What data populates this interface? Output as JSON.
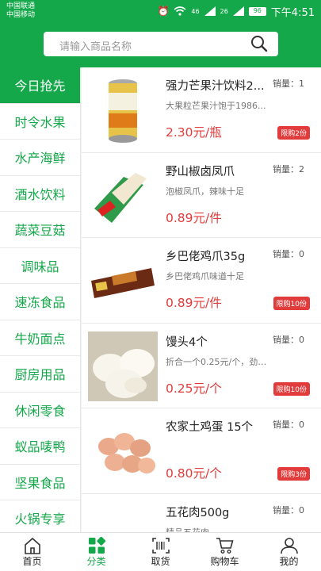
{
  "status_bar": {
    "carrier_1": "中国联通",
    "carrier_2": "中国移动",
    "network_1": "46",
    "network_2": "26",
    "battery": "96",
    "time": "下午4:51"
  },
  "search": {
    "placeholder": "请输入商品名称",
    "icon": "search-icon"
  },
  "accent_color": "#14a84a",
  "price_color": "#e23b3b",
  "categories": [
    {
      "label": "今日抢先",
      "active": true
    },
    {
      "label": "时令水果"
    },
    {
      "label": "水产海鲜"
    },
    {
      "label": "酒水饮料"
    },
    {
      "label": "蔬菜豆菇"
    },
    {
      "label": "调味品"
    },
    {
      "label": "速冻食品"
    },
    {
      "label": "牛奶面点"
    },
    {
      "label": "厨房用品"
    },
    {
      "label": "休闲零食"
    },
    {
      "label": "蚁品唛鸭"
    },
    {
      "label": "坚果食品"
    },
    {
      "label": "火锅专享"
    }
  ],
  "products": [
    {
      "name": "强力芒果汁饮料2...",
      "desc": "大果粒芒果汁饱于1986...",
      "price": "2.30元/瓶",
      "sold": "销量：1",
      "limit": "限购2份",
      "image": "drink-can"
    },
    {
      "name": "野山椒卤凤爪",
      "desc": "泡椒凤爪，辣味十足",
      "price": "0.89元/件",
      "sold": "销量：2",
      "limit": "",
      "image": "chicken-feet-pack"
    },
    {
      "name": "乡巴佬鸡爪35g",
      "desc": "乡巴佬鸡爪味道十足",
      "price": "0.89元/件",
      "sold": "销量：0",
      "limit": "限购10份",
      "image": "snack-pack"
    },
    {
      "name": "馒头4个",
      "desc": "折合一个0.25元/个，劲道...",
      "price": "0.25元/个",
      "sold": "销量：0",
      "limit": "限购10份",
      "image": "steamed-buns"
    },
    {
      "name": "农家土鸡蛋 15个",
      "desc": "",
      "price": "0.80元/个",
      "sold": "销量：0",
      "limit": "限购3份",
      "image": "eggs"
    },
    {
      "name": "五花肉500g",
      "desc": "精品五花肉",
      "price": "",
      "sold": "销量：0",
      "limit": "",
      "image": "pork-belly"
    }
  ],
  "bottom_nav": [
    {
      "label": "首页",
      "icon": "home-icon"
    },
    {
      "label": "分类",
      "icon": "category-icon",
      "active": true
    },
    {
      "label": "取货",
      "icon": "scan-icon"
    },
    {
      "label": "购物车",
      "icon": "cart-icon"
    },
    {
      "label": "我的",
      "icon": "user-icon"
    }
  ]
}
